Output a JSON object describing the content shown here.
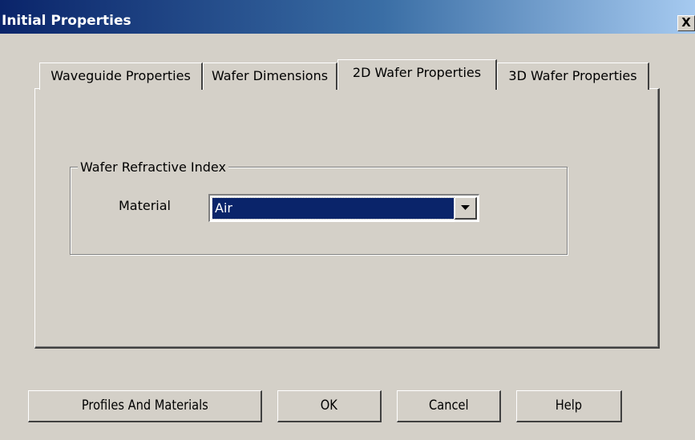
{
  "window": {
    "title": "Initial Properties",
    "close_label": "X"
  },
  "tabs": [
    {
      "label": "Waveguide Properties",
      "active": false
    },
    {
      "label": "Wafer Dimensions",
      "active": false
    },
    {
      "label": "2D Wafer Properties",
      "active": true
    },
    {
      "label": "3D Wafer Properties",
      "active": false
    }
  ],
  "group": {
    "title": "Wafer Refractive Index",
    "material_label": "Material",
    "material_value": "Air"
  },
  "buttons": {
    "profiles": "Profiles And Materials",
    "ok": "OK",
    "cancel": "Cancel",
    "help": "Help"
  },
  "colors": {
    "titlebar_start": "#0a246a",
    "titlebar_end": "#a6caf0",
    "selection": "#0a246a",
    "face": "#d4d0c8"
  },
  "icons": {
    "close": "close-icon",
    "dropdown": "chevron-down-icon"
  }
}
